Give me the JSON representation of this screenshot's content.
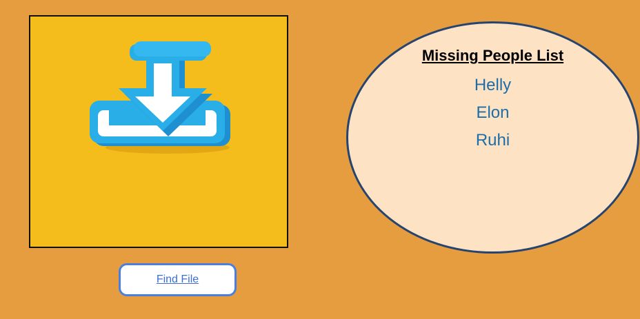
{
  "upload": {
    "icon": "download-tray-icon",
    "button_label": "Find File"
  },
  "missing": {
    "title": "Missing People List",
    "people": [
      "Helly",
      "Elon",
      "Ruhi"
    ]
  },
  "colors": {
    "page_background": "#e69d3f",
    "panel_background": "#f4bd1b",
    "icon_blue": "#2aaee8",
    "button_border": "#4a7fdf",
    "link": "#3c6ed6",
    "list_background": "#fde2c4",
    "list_border": "#26446e",
    "list_text": "#1d6ea8"
  }
}
